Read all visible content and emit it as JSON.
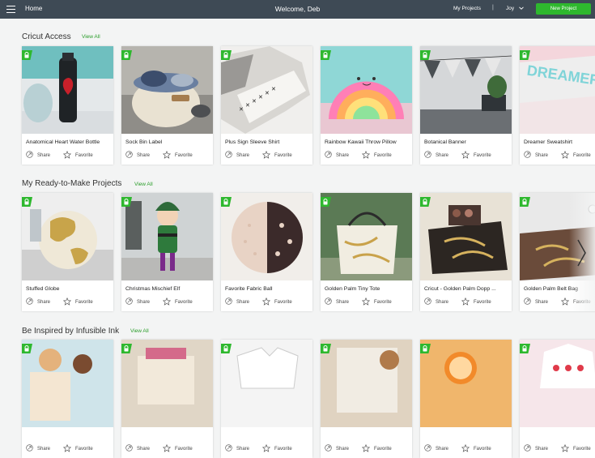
{
  "header": {
    "home_label": "Home",
    "welcome": "Welcome, Deb",
    "my_projects": "My Projects",
    "separator": "|",
    "user": "Joy",
    "new_project": "New Project"
  },
  "sections": [
    {
      "title": "Cricut Access",
      "view_all": "View All",
      "cards": [
        {
          "title": "Anatomical Heart Water Bottle"
        },
        {
          "title": "Sock Bin Label"
        },
        {
          "title": "Plus Sign Sleeve Shirt"
        },
        {
          "title": "Rainbow Kawaii Throw Pillow"
        },
        {
          "title": "Botanical Banner"
        },
        {
          "title": "Dreamer Sweatshirt"
        }
      ]
    },
    {
      "title": "My Ready-to-Make Projects",
      "view_all": "View All",
      "cards": [
        {
          "title": "Stuffed Globe"
        },
        {
          "title": "Christmas Mischief Elf"
        },
        {
          "title": "Favorite Fabric Ball"
        },
        {
          "title": "Golden Palm Tiny Tote"
        },
        {
          "title": "Cricut - Golden Palm Dopp ..."
        },
        {
          "title": "Golden Palm Belt Bag"
        }
      ]
    },
    {
      "title": "Be Inspired by Infusible Ink",
      "view_all": "View All",
      "cards": [
        {
          "title": ""
        },
        {
          "title": ""
        },
        {
          "title": ""
        },
        {
          "title": ""
        },
        {
          "title": ""
        },
        {
          "title": ""
        }
      ]
    }
  ],
  "card_actions": {
    "share": "Share",
    "favorite": "Favorite"
  },
  "colors": {
    "topbar": "#3e4a55",
    "accent_green": "#2eb82e",
    "page_bg": "#f3f4f4"
  }
}
